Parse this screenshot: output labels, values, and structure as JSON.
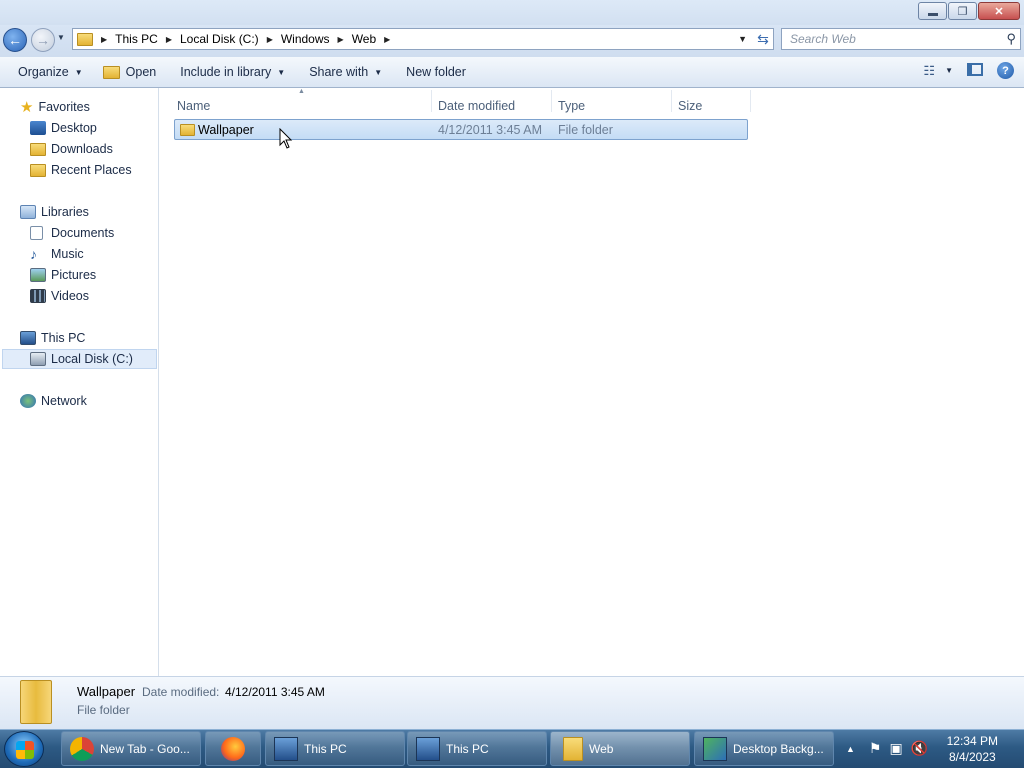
{
  "window": {
    "minimize": "▭",
    "restore": "❐",
    "close": "✕"
  },
  "address": {
    "crumbs": [
      "This PC",
      "Local Disk (C:)",
      "Windows",
      "Web"
    ]
  },
  "search": {
    "placeholder": "Search Web"
  },
  "toolbar": {
    "organize": "Organize",
    "open": "Open",
    "include": "Include in library",
    "share": "Share with",
    "new_folder": "New folder"
  },
  "nav": {
    "favorites": "Favorites",
    "desktop": "Desktop",
    "downloads": "Downloads",
    "recent": "Recent Places",
    "libraries": "Libraries",
    "documents": "Documents",
    "music": "Music",
    "pictures": "Pictures",
    "videos": "Videos",
    "thispc": "This PC",
    "localdisk": "Local Disk (C:)",
    "network": "Network"
  },
  "columns": {
    "name": "Name",
    "date": "Date modified",
    "type": "Type",
    "size": "Size"
  },
  "files": [
    {
      "name": "Wallpaper",
      "date": "4/12/2011 3:45 AM",
      "type": "File folder",
      "size": ""
    }
  ],
  "details": {
    "name": "Wallpaper",
    "date_label": "Date modified:",
    "date": "4/12/2011 3:45 AM",
    "type": "File folder"
  },
  "taskbar": {
    "chrome": "New Tab - Goo...",
    "thispc1": "This PC",
    "thispc2": "This PC",
    "web": "Web",
    "desktopbg": "Desktop Backg..."
  },
  "clock": {
    "time": "12:34 PM",
    "date": "8/4/2023"
  },
  "colors": {
    "selection": "#cfe3fa",
    "accent": "#2a64b7"
  }
}
